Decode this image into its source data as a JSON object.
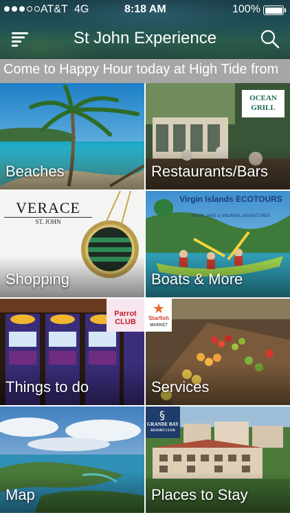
{
  "status_bar": {
    "carrier": "AT&T",
    "network": "4G",
    "time": "8:18 AM",
    "battery": "100%",
    "battery_level": 1.0,
    "signal_bars_filled": 3,
    "signal_bars_total": 5
  },
  "nav": {
    "title": "St John Experience",
    "menu_icon": "menu-icon",
    "search_icon": "search-icon"
  },
  "ticker": {
    "text": "Come to Happy Hour today at High Tide from"
  },
  "tiles": [
    {
      "label": "Beaches"
    },
    {
      "label": "Restaurants/Bars",
      "logo": "OCEAN GRILL"
    },
    {
      "label": "Shopping",
      "logo": "VERACE",
      "logo_sub": "ST. JOHN"
    },
    {
      "label": "Boats & More",
      "logo": "Virgin Islands ECOTOURS",
      "logo_sub": "KAYAK, HIKE & SNORKEL ADVENTURES"
    },
    {
      "label": "Things to do",
      "logo": "Parrot CLUB"
    },
    {
      "label": "Services",
      "logo": "Starfish",
      "logo_sub": "MARKET"
    },
    {
      "label": "Map"
    },
    {
      "label": "Places to Stay",
      "logo": "GRANDE BAY",
      "logo_sub": "RESORT CLUB"
    }
  ],
  "colors": {
    "ticker_bg": "#a6a6a6",
    "header_bg": "#1f4f55",
    "label_text": "#ffffff"
  }
}
